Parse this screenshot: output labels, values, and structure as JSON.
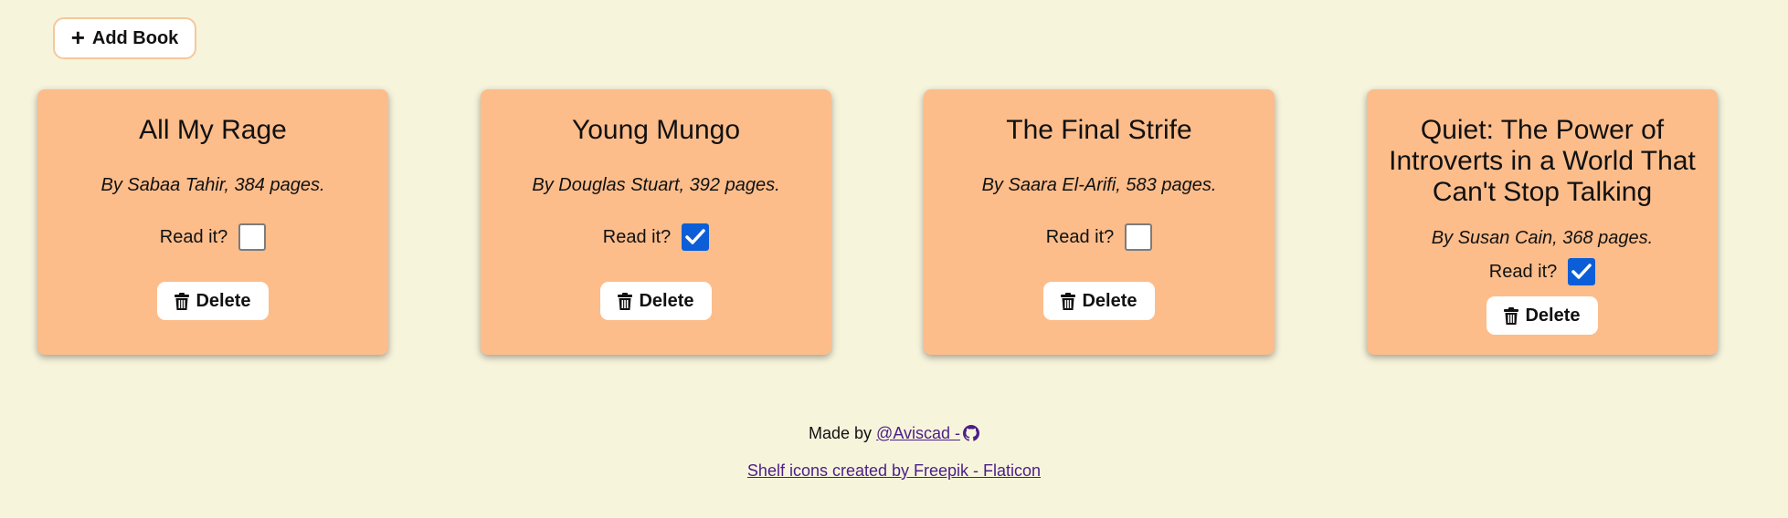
{
  "toolbar": {
    "add_label": "Add Book",
    "add_icon": "plus-icon"
  },
  "books": [
    {
      "title": "All My Rage",
      "author_line": "By Sabaa Tahir, 384 pages.",
      "read_label": "Read it?",
      "read": false,
      "delete_label": "Delete"
    },
    {
      "title": "Young Mungo",
      "author_line": "By Douglas Stuart, 392 pages.",
      "read_label": "Read it?",
      "read": true,
      "delete_label": "Delete"
    },
    {
      "title": "The Final Strife",
      "author_line": "By Saara El-Arifi, 583 pages.",
      "read_label": "Read it?",
      "read": false,
      "delete_label": "Delete"
    },
    {
      "title": "Quiet: The Power of Introverts in a World That Can't Stop Talking",
      "author_line": "By Susan Cain, 368 pages.",
      "read_label": "Read it?",
      "read": true,
      "delete_label": "Delete"
    }
  ],
  "footer": {
    "made_by": "Made by",
    "author_link": "@Aviscad -",
    "author_icon": "github-icon",
    "credit_link": "Shelf icons created by Freepik - Flaticon"
  },
  "colors": {
    "background": "#f7f4dc",
    "card": "#fcbd8b",
    "checked": "#0b5ed7",
    "link": "#4b1f86"
  }
}
